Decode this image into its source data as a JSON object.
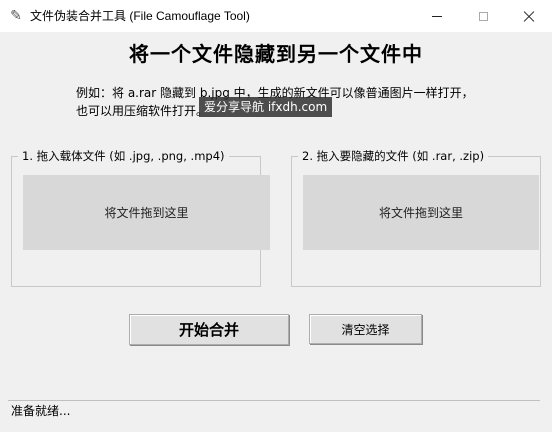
{
  "window": {
    "title": "文件伪装合并工具 (File Camouflage Tool)",
    "icon": "feather-icon"
  },
  "main": {
    "heading": "将一个文件隐藏到另一个文件中",
    "description_line1": "例如：将 a.rar 隐藏到 b.jpg 中，生成的新文件可以像普通图片一样打开，",
    "description_line2": "也可以用压缩软件打开。",
    "watermark": "爱分享导航 ifxdh.com"
  },
  "carrier_group": {
    "title": "1. 拖入载体文件 (如 .jpg, .png, .mp4)",
    "drop_hint": "将文件拖到这里"
  },
  "hidden_group": {
    "title": "2. 拖入要隐藏的文件 (如 .rar, .zip)",
    "drop_hint": "将文件拖到这里"
  },
  "buttons": {
    "merge_label": "开始合并",
    "clear_label": "清空选择"
  },
  "status": {
    "text": "准备就绪..."
  }
}
